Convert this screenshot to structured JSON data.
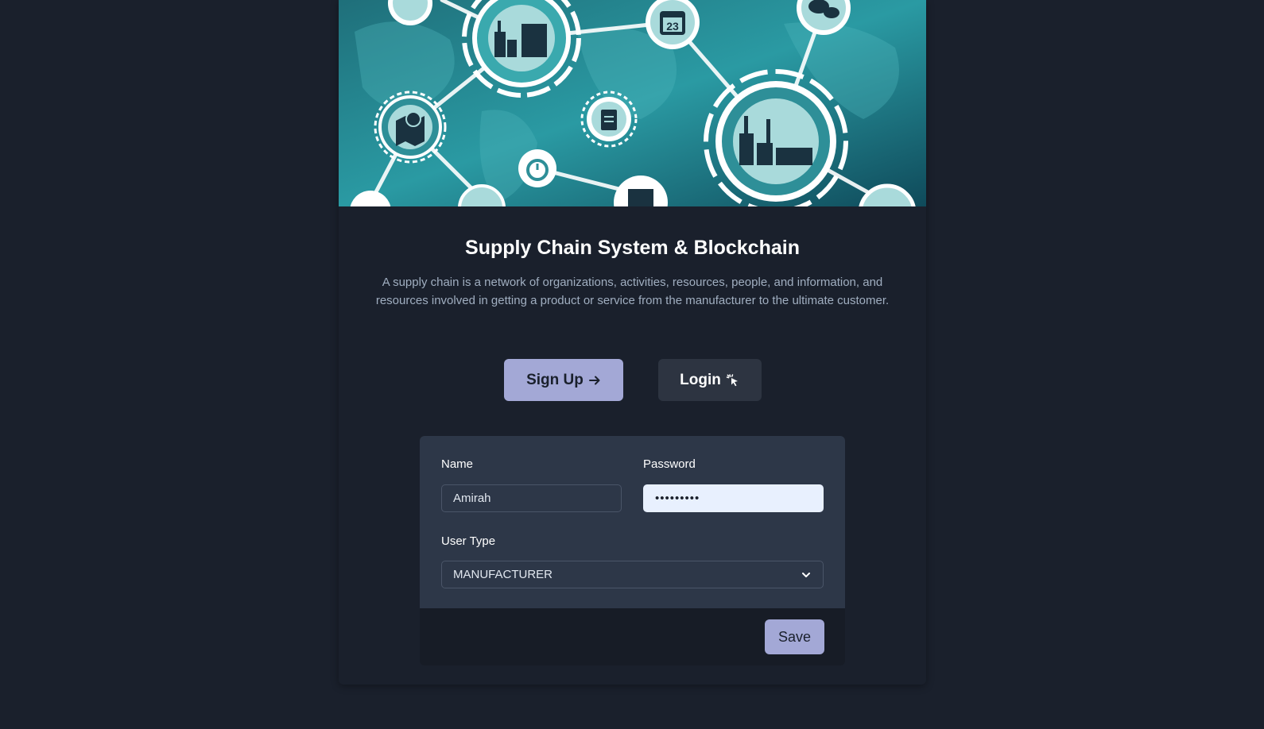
{
  "hero": {
    "calendar_day": "23"
  },
  "page": {
    "title": "Supply Chain System & Blockchain",
    "description": "A supply chain is a network of organizations, activities, resources, people, and information, and resources involved in getting a product or service from the manufacturer to the ultimate customer."
  },
  "actions": {
    "signup_label": "Sign Up",
    "login_label": "Login"
  },
  "form": {
    "name_label": "Name",
    "name_value": "Amirah",
    "password_label": "Password",
    "password_value": "•••••••••",
    "usertype_label": "User Type",
    "usertype_value": "MANUFACTURER",
    "save_label": "Save"
  },
  "colors": {
    "background": "#1a202c",
    "panel": "#2d3748",
    "accent": "#a3a8d6",
    "input_autofill": "#e8f0fe"
  },
  "icons": [
    "arrow-right-icon",
    "cursor-click-icon",
    "chevron-down-icon",
    "factory-icon",
    "calendar-icon",
    "map-pin-icon",
    "clipboard-icon",
    "stopwatch-icon",
    "chat-icon",
    "box-icon"
  ]
}
